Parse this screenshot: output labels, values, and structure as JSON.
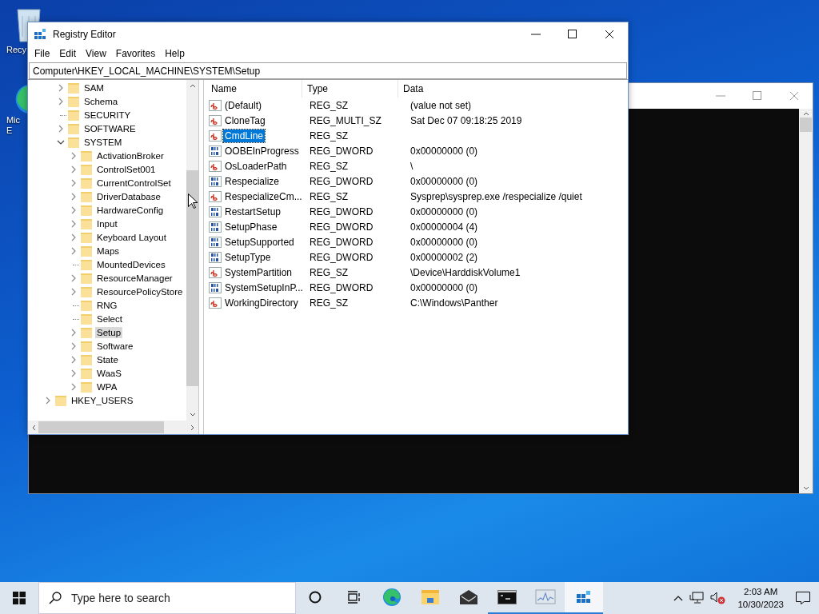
{
  "desktop_icons": [
    {
      "kind": "recycle-bin",
      "label_lines": [
        "Recy"
      ]
    },
    {
      "kind": "edge",
      "label_lines": [
        "Mic",
        "E"
      ]
    }
  ],
  "console_window": {
    "scrollbar": true
  },
  "registry_window": {
    "title": "Registry Editor",
    "menu": [
      "File",
      "Edit",
      "View",
      "Favorites",
      "Help"
    ],
    "address": "Computer\\HKEY_LOCAL_MACHINE\\SYSTEM\\Setup",
    "tree": [
      {
        "children": [
          {
            "label": "SAM",
            "has_children": true,
            "expanded": false,
            "selected": false
          },
          {
            "label": "Schema",
            "has_children": true,
            "expanded": false,
            "selected": false
          },
          {
            "label": "SECURITY",
            "has_children": false,
            "selected": false
          },
          {
            "label": "SOFTWARE",
            "has_children": true,
            "expanded": false,
            "selected": false
          },
          {
            "label": "SYSTEM",
            "has_children": true,
            "expanded": true,
            "selected": false,
            "children": [
              {
                "label": "ActivationBroker",
                "has_children": true,
                "expanded": false,
                "selected": false
              },
              {
                "label": "ControlSet001",
                "has_children": true,
                "expanded": false,
                "selected": false
              },
              {
                "label": "CurrentControlSet",
                "has_children": true,
                "expanded": false,
                "selected": false
              },
              {
                "label": "DriverDatabase",
                "has_children": true,
                "expanded": false,
                "selected": false
              },
              {
                "label": "HardwareConfig",
                "has_children": true,
                "expanded": false,
                "selected": false
              },
              {
                "label": "Input",
                "has_children": true,
                "expanded": false,
                "selected": false
              },
              {
                "label": "Keyboard Layout",
                "has_children": true,
                "expanded": false,
                "selected": false
              },
              {
                "label": "Maps",
                "has_children": true,
                "expanded": false,
                "selected": false
              },
              {
                "label": "MountedDevices",
                "has_children": false,
                "selected": false
              },
              {
                "label": "ResourceManager",
                "has_children": true,
                "expanded": false,
                "selected": false
              },
              {
                "label": "ResourcePolicyStore",
                "has_children": true,
                "expanded": false,
                "selected": false
              },
              {
                "label": "RNG",
                "has_children": false,
                "selected": false
              },
              {
                "label": "Select",
                "has_children": false,
                "selected": false
              },
              {
                "label": "Setup",
                "has_children": true,
                "expanded": false,
                "selected": true
              },
              {
                "label": "Software",
                "has_children": true,
                "expanded": false,
                "selected": false
              },
              {
                "label": "State",
                "has_children": true,
                "expanded": false,
                "selected": false
              },
              {
                "label": "WaaS",
                "has_children": true,
                "expanded": false,
                "selected": false
              },
              {
                "label": "WPA",
                "has_children": true,
                "expanded": false,
                "selected": false
              }
            ]
          }
        ]
      },
      {
        "label": "HKEY_USERS",
        "has_children": true,
        "expanded": false,
        "selected": false
      }
    ],
    "columns": [
      "Name",
      "Type",
      "Data"
    ],
    "values": [
      {
        "kind": "string",
        "name": "(Default)",
        "type": "REG_SZ",
        "data": "(value not set)",
        "selected": false
      },
      {
        "kind": "string",
        "name": "CloneTag",
        "type": "REG_MULTI_SZ",
        "data": "Sat Dec 07 09:18:25 2019",
        "selected": false
      },
      {
        "kind": "string",
        "name": "CmdLine",
        "type": "REG_SZ",
        "selected": true
      },
      {
        "kind": "binary",
        "name": "OOBEInProgress",
        "type": "REG_DWORD",
        "data": "0x00000000 (0)",
        "selected": false
      },
      {
        "kind": "string",
        "name": "OsLoaderPath",
        "type": "REG_SZ",
        "data": "\\",
        "selected": false
      },
      {
        "kind": "binary",
        "name": "Respecialize",
        "type": "REG_DWORD",
        "data": "0x00000000 (0)",
        "selected": false
      },
      {
        "kind": "string",
        "name": "RespecializeCm...",
        "type": "REG_SZ",
        "data": "Sysprep\\sysprep.exe /respecialize /quiet",
        "selected": false
      },
      {
        "kind": "binary",
        "name": "RestartSetup",
        "type": "REG_DWORD",
        "data": "0x00000000 (0)",
        "selected": false
      },
      {
        "kind": "binary",
        "name": "SetupPhase",
        "type": "REG_DWORD",
        "data": "0x00000004 (4)",
        "selected": false
      },
      {
        "kind": "binary",
        "name": "SetupSupported",
        "type": "REG_DWORD",
        "data": "0x00000000 (0)",
        "selected": false
      },
      {
        "kind": "binary",
        "name": "SetupType",
        "type": "REG_DWORD",
        "data": "0x00000002 (2)",
        "selected": false
      },
      {
        "kind": "string",
        "name": "SystemPartition",
        "type": "REG_SZ",
        "data": "\\Device\\HarddiskVolume1",
        "selected": false
      },
      {
        "kind": "binary",
        "name": "SystemSetupInP...",
        "type": "REG_DWORD",
        "data": "0x00000000 (0)",
        "selected": false
      },
      {
        "kind": "string",
        "name": "WorkingDirectory",
        "type": "REG_SZ",
        "data": "C:\\Windows\\Panther",
        "selected": false
      }
    ]
  },
  "taskbar": {
    "search": {
      "placeholder": "Type here to search"
    },
    "apps": [
      {
        "kind": "cortana",
        "running": false,
        "active": false
      },
      {
        "kind": "task-view",
        "running": false,
        "active": false
      },
      {
        "kind": "edge",
        "running": false,
        "active": false
      },
      {
        "kind": "explorer",
        "running": false,
        "active": false
      },
      {
        "kind": "mail",
        "running": false,
        "active": false
      },
      {
        "kind": "console",
        "running": true,
        "active": false
      },
      {
        "kind": "monitor",
        "running": true,
        "active": false
      },
      {
        "kind": "registry",
        "running": true,
        "active": true
      }
    ],
    "tray": {
      "time": "2:03 AM",
      "date": "10/30/2023",
      "volume_muted": true
    }
  }
}
